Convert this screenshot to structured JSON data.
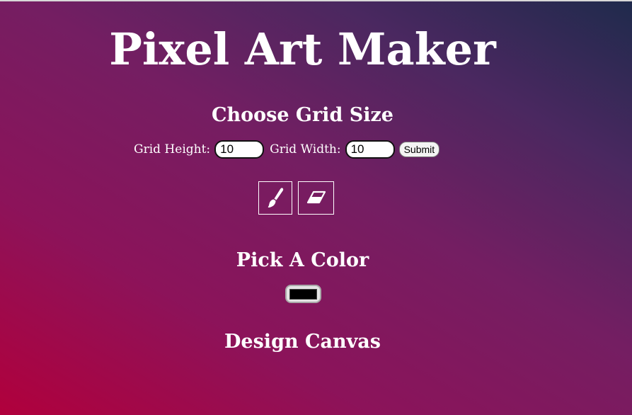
{
  "page": {
    "title": "Pixel Art Maker"
  },
  "grid_size": {
    "heading": "Choose Grid Size",
    "height_label": "Grid Height:",
    "height_value": "10",
    "width_label": "Grid Width:",
    "width_value": "10",
    "submit_label": "Submit"
  },
  "tools": [
    {
      "name": "brush",
      "icon": "paintbrush-icon"
    },
    {
      "name": "eraser",
      "icon": "eraser-icon"
    }
  ],
  "color": {
    "heading": "Pick A Color",
    "selected_color": "#000000"
  },
  "canvas": {
    "heading": "Design Canvas"
  },
  "colors": {
    "gradient_start": "#b1003c",
    "gradient_mid": "#741e62",
    "gradient_end": "#1f2a4c",
    "text": "#ffffff"
  }
}
